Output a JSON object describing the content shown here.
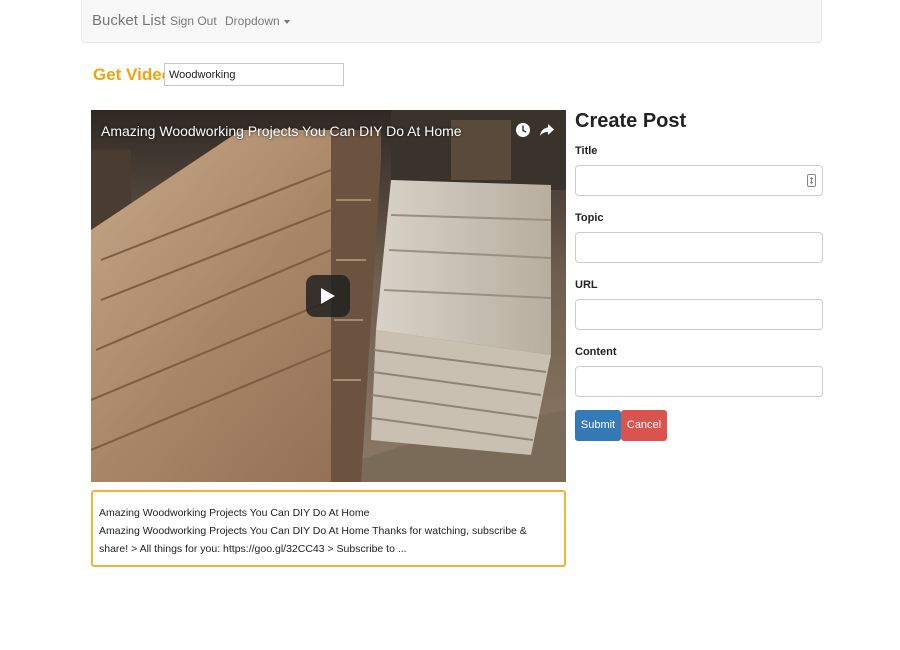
{
  "navbar": {
    "brand": "Bucket List",
    "signout": "Sign Out",
    "dropdown": "Dropdown"
  },
  "search": {
    "label": "Get Video:",
    "value": "Woodworking"
  },
  "video": {
    "title": "Amazing Woodworking Projects You Can DIY Do At Home",
    "icons": [
      "clock-icon",
      "share-icon",
      "play-icon"
    ]
  },
  "description": {
    "title": "Amazing Woodworking Projects You Can DIY Do At Home",
    "text": "Amazing Woodworking Projects You Can DIY Do At Home Thanks for watching, subscribe & share! > All things for you: https://goo.gl/32CC43 > Subscribe to ..."
  },
  "form": {
    "title": "Create Post",
    "fields": [
      {
        "label": "Title",
        "value": ""
      },
      {
        "label": "Topic",
        "value": ""
      },
      {
        "label": "URL",
        "value": ""
      },
      {
        "label": "Content",
        "value": ""
      }
    ],
    "submit": "Submit",
    "cancel": "Cancel"
  },
  "colors": {
    "accent": "#f0a30a",
    "submit": "#337ab7",
    "cancel": "#d9534f",
    "highlight_border": "#f5b13b"
  }
}
